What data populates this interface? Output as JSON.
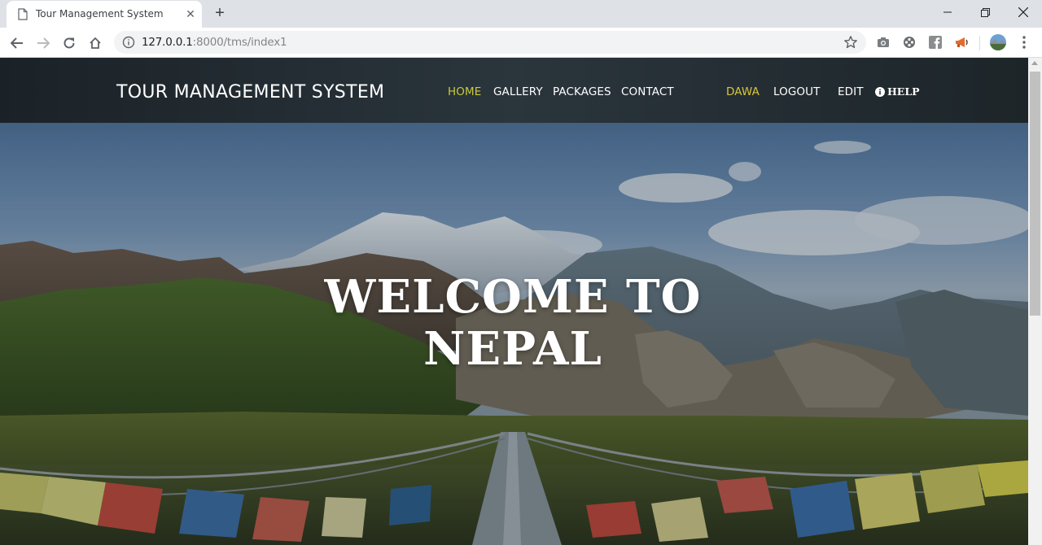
{
  "browser": {
    "tab_title": "Tour Management System",
    "url_host": "127.0.0.1",
    "url_path": ":8000/tms/index1"
  },
  "site": {
    "brand": "TOUR MANAGEMENT SYSTEM",
    "nav": {
      "home": "HOME",
      "gallery": "GALLERY",
      "packages": "PACKAGES",
      "contact": "CONTACT",
      "user": "DAWA",
      "logout": "LOGOUT",
      "edit": "EDIT",
      "help": "HELP"
    },
    "hero": {
      "line1": "WELCOME TO",
      "line2": "NEPAL"
    }
  },
  "colors": {
    "active_link": "#c9c93a",
    "user_link": "#d9c43c",
    "navbar": "#232c32"
  }
}
